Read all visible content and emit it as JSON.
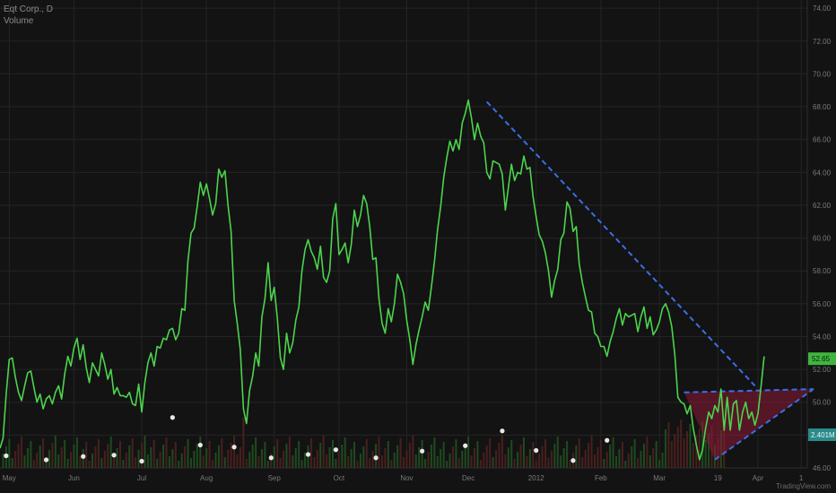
{
  "legend": {
    "title": "Eqt Corp., D",
    "volume": "Volume"
  },
  "watermark": "TradingView.com",
  "chart_data": {
    "type": "line",
    "title": "Eqt Corp., D",
    "ylim": [
      46,
      74.5
    ],
    "y_ticks": [
      "46.00",
      "48.00",
      "50.00",
      "52.00",
      "54.00",
      "56.00",
      "58.00",
      "60.00",
      "62.00",
      "64.00",
      "66.00",
      "68.00",
      "70.00",
      "72.00",
      "74.00"
    ],
    "x_ticks": [
      {
        "label": "May",
        "index": 3
      },
      {
        "label": "Jun",
        "index": 24
      },
      {
        "label": "Jul",
        "index": 46
      },
      {
        "label": "Aug",
        "index": 67
      },
      {
        "label": "Sep",
        "index": 89
      },
      {
        "label": "Oct",
        "index": 110
      },
      {
        "label": "Nov",
        "index": 132
      },
      {
        "label": "Dec",
        "index": 152
      },
      {
        "label": "2012",
        "index": 174
      },
      {
        "label": "Feb",
        "index": 195
      },
      {
        "label": "Mar",
        "index": 214
      },
      {
        "label": "19",
        "index": 233
      },
      {
        "label": "Apr",
        "index": 246
      },
      {
        "label": "1",
        "index": 260
      }
    ],
    "x_range": [
      0,
      262
    ],
    "last_price": {
      "value": 52.65,
      "label": "52.65",
      "color": "#3fb53f"
    },
    "volume_label": {
      "label": "2.401M",
      "color": "#2a8a8a"
    },
    "series": [
      {
        "color": "#4cd44c",
        "values": [
          47.2,
          47.8,
          50.5,
          52.6,
          52.7,
          51.5,
          50.6,
          50.1,
          51.0,
          51.8,
          51.9,
          50.9,
          50.0,
          50.5,
          49.6,
          50.2,
          50.4,
          49.9,
          50.6,
          51.0,
          50.2,
          51.7,
          52.8,
          52.2,
          53.3,
          53.9,
          52.6,
          53.5,
          52.1,
          51.2,
          52.4,
          52.0,
          51.6,
          53.0,
          52.3,
          51.4,
          52.0,
          50.5,
          50.9,
          50.4,
          50.4,
          50.3,
          50.6,
          49.9,
          49.8,
          51.1,
          49.4,
          51.2,
          52.4,
          53.0,
          52.2,
          53.4,
          53.3,
          53.9,
          53.8,
          54.4,
          54.5,
          53.8,
          54.2,
          55.7,
          55.6,
          58.6,
          60.3,
          60.6,
          61.9,
          63.4,
          62.6,
          63.3,
          62.4,
          61.4,
          62.1,
          64.2,
          63.7,
          64.1,
          62.0,
          60.4,
          56.2,
          54.8,
          53.2,
          49.6,
          48.7,
          50.7,
          51.6,
          53.0,
          52.2,
          55.2,
          56.3,
          58.5,
          56.2,
          57.0,
          55.1,
          52.7,
          52.0,
          54.2,
          53.0,
          53.6,
          55.0,
          55.8,
          58.0,
          59.3,
          59.9,
          59.2,
          58.8,
          58.1,
          59.5,
          57.6,
          57.3,
          58.0,
          61.2,
          62.1,
          59.0,
          59.3,
          59.7,
          58.5,
          59.6,
          61.7,
          60.7,
          61.4,
          62.6,
          62.1,
          60.7,
          58.7,
          58.8,
          56.3,
          54.8,
          54.2,
          55.7,
          54.9,
          56.0,
          57.8,
          57.3,
          56.6,
          55.0,
          53.8,
          52.3,
          53.5,
          54.4,
          55.2,
          56.1,
          55.6,
          57.0,
          58.6,
          60.5,
          61.9,
          63.7,
          64.9,
          65.9,
          65.3,
          66.0,
          65.4,
          67.0,
          67.6,
          68.4,
          67.3,
          66.0,
          67.0,
          66.2,
          65.8,
          64.0,
          63.6,
          64.7,
          64.6,
          64.5,
          63.9,
          61.7,
          63.1,
          64.5,
          63.5,
          64.0,
          63.9,
          65.0,
          64.2,
          64.3,
          62.5,
          61.3,
          60.2,
          59.8,
          59.1,
          58.0,
          56.4,
          57.4,
          58.1,
          59.9,
          60.3,
          62.2,
          61.8,
          60.4,
          60.7,
          58.4,
          57.3,
          56.4,
          55.6,
          55.5,
          54.2,
          54.0,
          53.4,
          53.4,
          52.8,
          53.7,
          54.3,
          55.1,
          55.7,
          54.7,
          55.4,
          55.2,
          55.3,
          55.4,
          54.3,
          55.2,
          55.8,
          54.5,
          55.2,
          54.1,
          54.4,
          54.9,
          55.7,
          56.0,
          55.5,
          54.6,
          52.9,
          50.3,
          50.0,
          49.9,
          49.3,
          49.8,
          48.4,
          47.4,
          46.5,
          47.1,
          48.4,
          49.4,
          49.0,
          49.8,
          49.4,
          50.8,
          48.3,
          50.3,
          48.3,
          49.9,
          50.1,
          48.3,
          49.4,
          50.0,
          49.0,
          49.4,
          48.6,
          49.3,
          51.0,
          52.8
        ]
      }
    ],
    "volume_bars": {
      "count": 236,
      "color_up": "#1f4a1f",
      "color_down": "#4a1f1f"
    },
    "dividend_markers": [
      {
        "index": 2,
        "value": 0.18
      },
      {
        "index": 15,
        "value": 0.12
      },
      {
        "index": 27,
        "value": 0.17
      },
      {
        "index": 37,
        "value": 0.19
      },
      {
        "index": 46,
        "value": 0.1
      },
      {
        "index": 56,
        "value": 0.75
      },
      {
        "index": 65,
        "value": 0.34
      },
      {
        "index": 76,
        "value": 0.31
      },
      {
        "index": 88,
        "value": 0.15
      },
      {
        "index": 100,
        "value": 0.2
      },
      {
        "index": 109,
        "value": 0.27
      },
      {
        "index": 122,
        "value": 0.15
      },
      {
        "index": 137,
        "value": 0.25
      },
      {
        "index": 151,
        "value": 0.33
      },
      {
        "index": 163,
        "value": 0.55
      },
      {
        "index": 174,
        "value": 0.26
      },
      {
        "index": 186,
        "value": 0.11
      },
      {
        "index": 197,
        "value": 0.41
      }
    ],
    "drawings": {
      "resistance_line": {
        "from": {
          "index": 158,
          "value": 68.3
        },
        "to": {
          "index": 245,
          "value": 51.0
        },
        "color": "#3a6fe8"
      },
      "triangle": {
        "points": [
          {
            "index": 222,
            "value": 50.6
          },
          {
            "index": 264,
            "value": 50.8
          },
          {
            "index": 232,
            "value": 46.5
          }
        ],
        "fill": "rgba(140,25,55,0.55)",
        "stroke": "#3a6fe8"
      }
    }
  }
}
